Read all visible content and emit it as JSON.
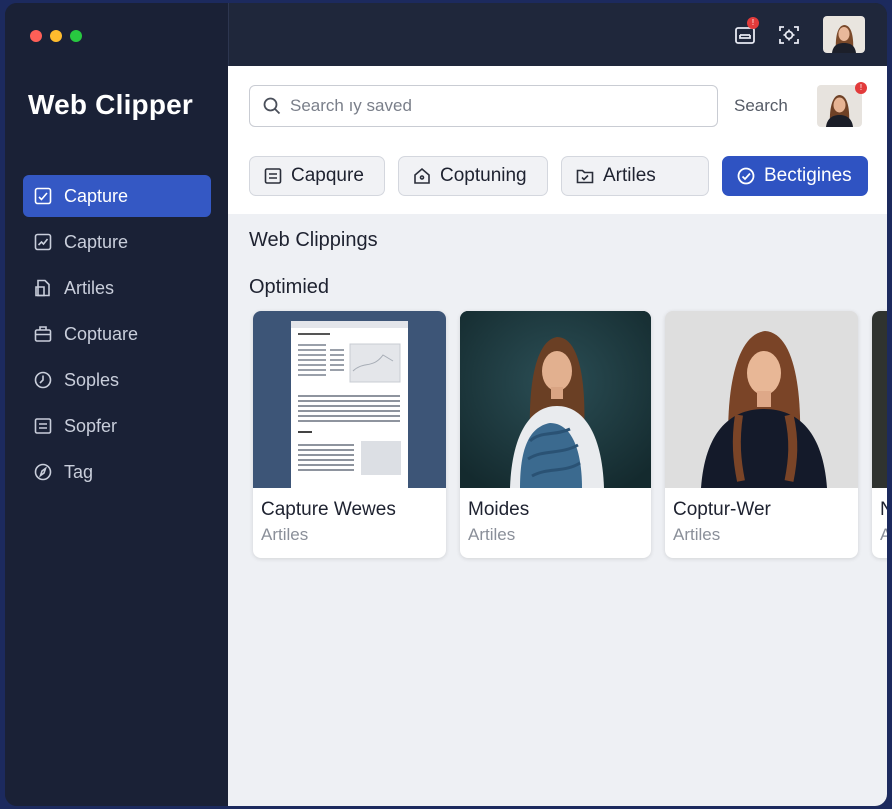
{
  "app": {
    "title": "Web Clipper"
  },
  "window_controls": {
    "close_color": "#ff5f57",
    "minimize_color": "#febc2e",
    "zoom_color": "#28c840"
  },
  "sidebar": {
    "items": [
      {
        "label": "Capture",
        "icon": "chart-box-icon",
        "active": true
      },
      {
        "label": "Capture",
        "icon": "chart-check-icon",
        "active": false
      },
      {
        "label": "Artiles",
        "icon": "document-icon",
        "active": false
      },
      {
        "label": "Coptuare",
        "icon": "briefcase-icon",
        "active": false
      },
      {
        "label": "Soples",
        "icon": "clock-icon",
        "active": false
      },
      {
        "label": "Sopfer",
        "icon": "list-box-icon",
        "active": false
      },
      {
        "label": "Tag",
        "icon": "compass-icon",
        "active": false
      }
    ]
  },
  "topbar": {
    "notification_badge": "!",
    "icons": [
      "inbox-icon",
      "capture-icon",
      "user-avatar"
    ]
  },
  "search": {
    "placeholder": "Search ıy saved",
    "label": "Search",
    "avatar_badge": "!"
  },
  "chips": [
    {
      "label": "Capqure",
      "icon": "list-box-icon",
      "active": false
    },
    {
      "label": "Coptuning",
      "icon": "home-icon",
      "active": false
    },
    {
      "label": "Artiles",
      "icon": "folder-check-icon",
      "active": false
    },
    {
      "label": "Bectigines",
      "icon": "check-circle-icon",
      "active": true
    }
  ],
  "sections": {
    "heading": "Web Clippings",
    "subheading": "Optimied"
  },
  "cards": [
    {
      "title": "Capture Wewes",
      "subtitle": "Artiles",
      "thumb": "document-page"
    },
    {
      "title": "Moides",
      "subtitle": "Artiles",
      "thumb": "portrait-dark"
    },
    {
      "title": "Coptur-Wer",
      "subtitle": "Artiles",
      "thumb": "portrait-light"
    },
    {
      "title": "N",
      "subtitle": "A",
      "thumb": "portrait-dark"
    }
  ],
  "colors": {
    "accent": "#3458c4",
    "sidebar_bg": "#1a2136",
    "badge": "#e23b3b"
  }
}
